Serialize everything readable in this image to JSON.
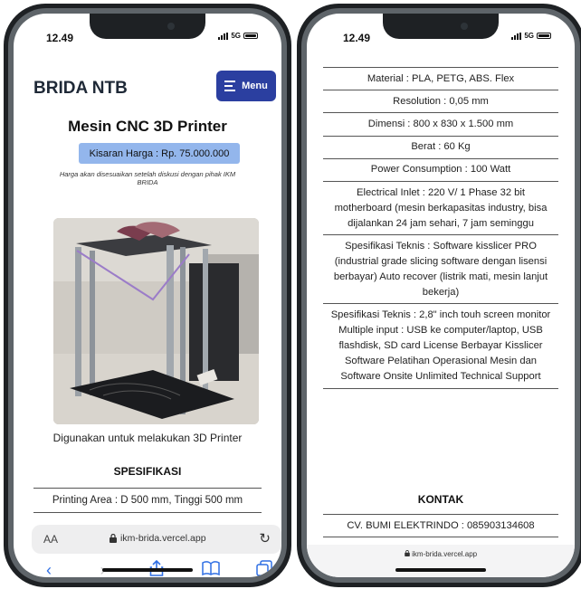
{
  "left_phone": {
    "status": {
      "time": "12.49",
      "network": "5G"
    },
    "header": {
      "brand": "BRIDA NTB",
      "menu_label": "Menu"
    },
    "product": {
      "title": "Mesin CNC 3D Printer",
      "price": "Kisaran Harga : Rp. 75.000.000",
      "note": "Harga akan disesuaikan setelah diskusi dengan pihak IKM BRIDA",
      "caption": "Digunakan untuk melakukan 3D Printer"
    },
    "spec_heading": "SPESIFIKASI",
    "spec_first_row": "Printing Area : D 500 mm, Tinggi 500 mm",
    "browser": {
      "aa_label": "AA",
      "url": "ikm-brida.vercel.app"
    }
  },
  "right_phone": {
    "status": {
      "time": "12.49",
      "network": "5G"
    },
    "specs": [
      "Material : PLA, PETG, ABS. Flex",
      "Resolution : 0,05 mm",
      "Dimensi : 800 x 830 x 1.500 mm",
      "Berat : 60 Kg",
      "Power Consumption : 100 Watt",
      "Electrical Inlet : 220 V/ 1 Phase 32 bit motherboard (mesin berkapasitas industry, bisa dijalankan 24 jam sehari, 7 jam seminggu",
      "Spesifikasi Teknis : Software kisslicer PRO (industrial grade slicing software dengan lisensi berbayar) Auto recover (listrik mati, mesin lanjut bekerja)",
      "Spesifikasi Teknis : 2,8\" inch touh screen monitor Multiple input : USB ke computer/laptop, USB flashdisk, SD card License Berbayar Kisslicer Software Pelatihan Operasional Mesin dan Software Onsite Unlimited Technical Support"
    ],
    "kontak_heading": "KONTAK",
    "kontak_value": "CV. BUMI ELEKTRINDO : 085903134608",
    "url": "ikm-brida.vercel.app"
  },
  "colors": {
    "menu_button": "#2b3fa0",
    "price_badge": "#93b6ec",
    "safari_blue": "#2f6fe4"
  }
}
